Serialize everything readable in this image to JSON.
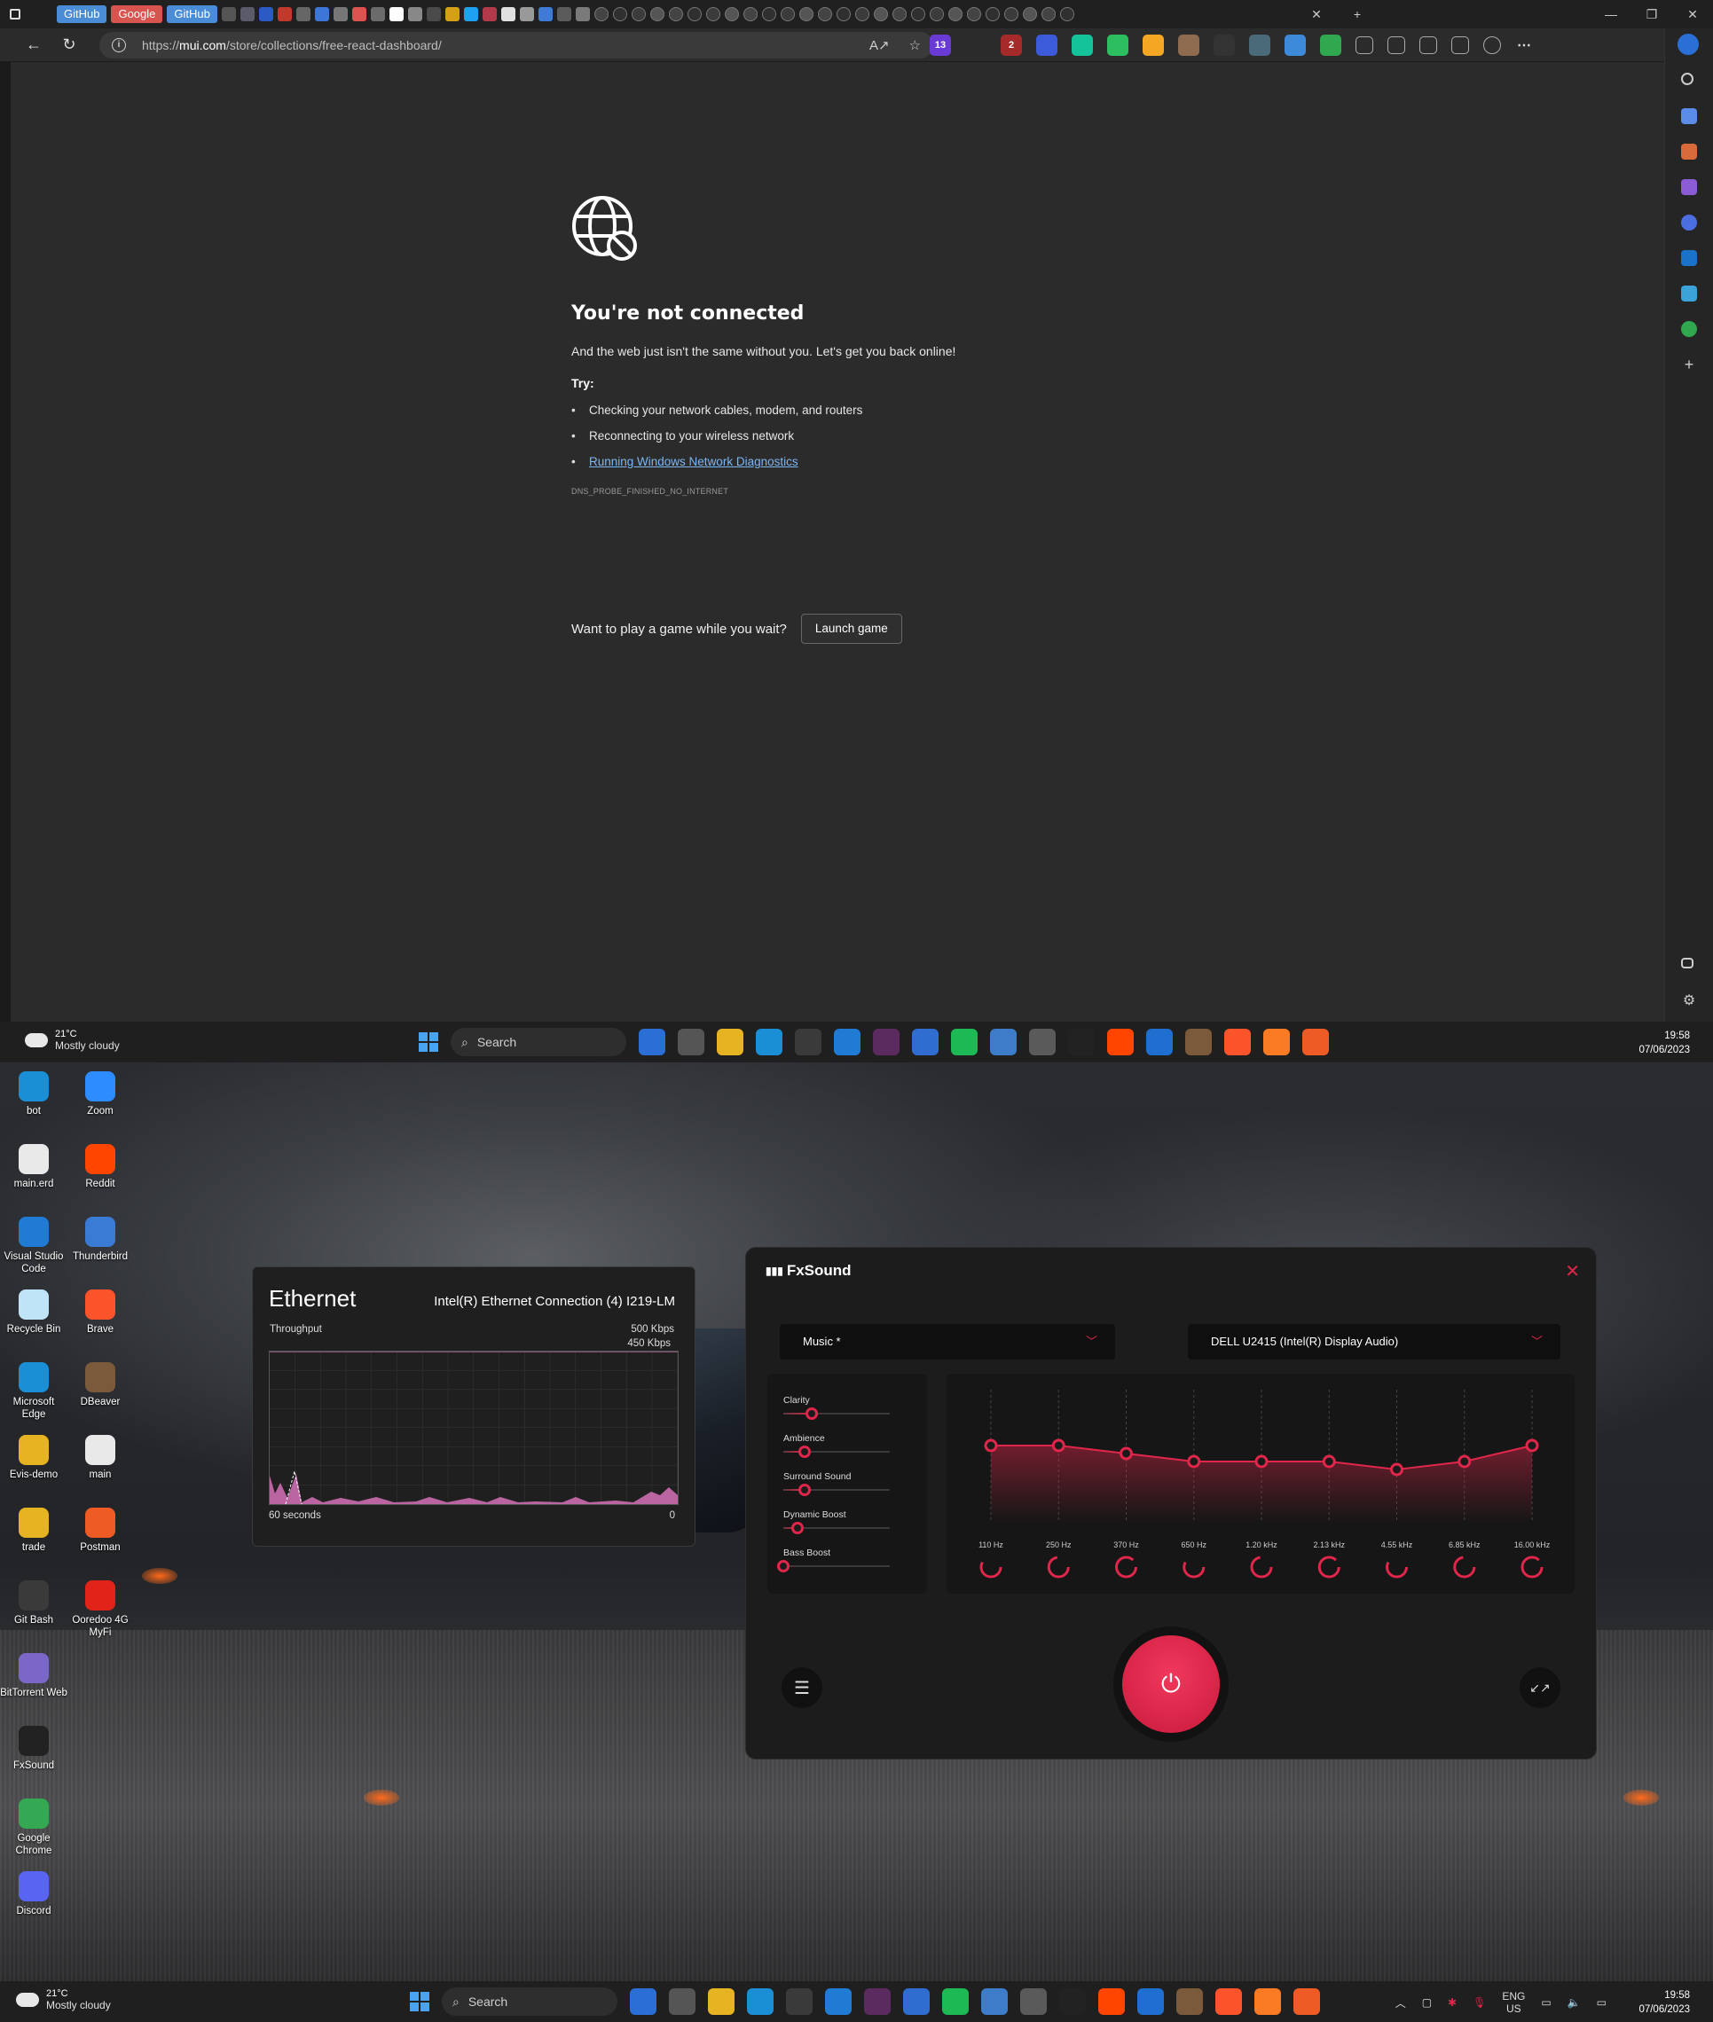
{
  "browser": {
    "tabs": {
      "pinned_labels": [
        "GitHub",
        "Google",
        "GitHub"
      ],
      "tab_colors": [
        "#555555",
        "#5a5a6a",
        "#2a5bc4",
        "#c0392b",
        "#666666",
        "#3a77d8",
        "#777777",
        "#d9534f",
        "#6b6b6b",
        "#ffffff",
        "#888888",
        "#4a4a4a",
        "#d4a017",
        "#1da1f2",
        "#b23a48",
        "#e0e0e0",
        "#999999",
        "#3e7bd6",
        "#5b5b5b",
        "#7a7a7a"
      ]
    },
    "address": {
      "url_prefix": "https://",
      "url_host": "mui.com",
      "url_path": "/store/collections/free-react-dashboard/"
    },
    "extensions": [
      {
        "icon": "extension-13-icon",
        "badge": "13",
        "color": "#6a3bd4"
      },
      {
        "icon": "x-extension-icon",
        "badge": "",
        "color": "#2b2b2b"
      },
      {
        "icon": "ublock-icon",
        "badge": "2",
        "color": "#a52a2a"
      },
      {
        "icon": "chart-extension-icon",
        "badge": "",
        "color": "#3b5bdb"
      },
      {
        "icon": "grammarly-icon",
        "badge": "",
        "color": "#15c39a"
      },
      {
        "icon": "evernote-icon",
        "badge": "",
        "color": "#2dbe60"
      },
      {
        "icon": "honey-icon",
        "badge": "",
        "color": "#f5a623"
      },
      {
        "icon": "avatar-extension-icon",
        "badge": "",
        "color": "#8e6b4f"
      },
      {
        "icon": "hat-extension-icon",
        "badge": "",
        "color": "#333333"
      },
      {
        "icon": "pen-extension-icon",
        "badge": "",
        "color": "#4a6a7a"
      },
      {
        "icon": "eyedropper-icon",
        "badge": "",
        "color": "#3d8bd8"
      },
      {
        "icon": "shield-icon",
        "badge": "",
        "color": "#2fa84f"
      }
    ],
    "error_page": {
      "title": "You're not connected",
      "subtitle": "And the web just isn't the same without you. Let's get you back online!",
      "try_label": "Try:",
      "suggestions": [
        "Checking your network cables, modem, and routers",
        "Reconnecting to your wireless network"
      ],
      "diagnostics_link": "Running Windows Network Diagnostics",
      "error_code": "DNS_PROBE_FINISHED_NO_INTERNET",
      "game_prompt": "Want to play a game while you wait?",
      "game_button": "Launch game"
    }
  },
  "taskbar": {
    "temperature": "21°C",
    "condition": "Mostly cloudy",
    "search_placeholder": "Search",
    "time": "19:58",
    "date": "07/06/2023",
    "language": "ENG",
    "region": "US",
    "apps": [
      {
        "icon": "copilot-icon",
        "color": "#2b6fd6"
      },
      {
        "icon": "task-view-icon",
        "color": "#555555"
      },
      {
        "icon": "file-explorer-icon",
        "color": "#e6b422"
      },
      {
        "icon": "edge-icon",
        "color": "#1b8fd6"
      },
      {
        "icon": "terminal-icon",
        "color": "#3a3a3a"
      },
      {
        "icon": "vscode-icon",
        "color": "#1f7bd3"
      },
      {
        "icon": "slack-icon",
        "color": "#5b2a5e"
      },
      {
        "icon": "app-store-icon",
        "color": "#2f6dd0"
      },
      {
        "icon": "spotify-icon",
        "color": "#1db954"
      },
      {
        "icon": "photos-icon",
        "color": "#3d7cc9"
      },
      {
        "icon": "settings-icon",
        "color": "#5a5a5a"
      },
      {
        "icon": "fxsound-icon",
        "color": "#222222"
      },
      {
        "icon": "reddit-icon",
        "color": "#ff4500"
      },
      {
        "icon": "onedrive-icon",
        "color": "#1e6fd0"
      },
      {
        "icon": "dbeaver-icon",
        "color": "#7a5a3a"
      },
      {
        "icon": "brave-icon",
        "color": "#fb542b"
      },
      {
        "icon": "xampp-icon",
        "color": "#fb7a24"
      },
      {
        "icon": "postman-icon",
        "color": "#ef5b25"
      }
    ]
  },
  "desktop_icons": [
    {
      "label": "bot",
      "icon": "edge-icon",
      "color": "#1b8fd6"
    },
    {
      "label": "Zoom",
      "icon": "zoom-icon",
      "color": "#2d8cff"
    },
    {
      "label": "main.erd",
      "icon": "file-icon",
      "color": "#e9e9e9"
    },
    {
      "label": "Reddit",
      "icon": "reddit-icon",
      "color": "#ff4500"
    },
    {
      "label": "Visual Studio Code",
      "icon": "vscode-icon",
      "color": "#1f7bd3"
    },
    {
      "label": "Thunderbird",
      "icon": "thunderbird-icon",
      "color": "#3a7bd5"
    },
    {
      "label": "Recycle Bin",
      "icon": "recycle-bin-icon",
      "color": "#bfe3f7"
    },
    {
      "label": "Brave",
      "icon": "brave-icon",
      "color": "#fb542b"
    },
    {
      "label": "Microsoft Edge",
      "icon": "edge-icon",
      "color": "#1b8fd6"
    },
    {
      "label": "DBeaver",
      "icon": "dbeaver-icon",
      "color": "#7a5a3a"
    },
    {
      "label": "Evis-demo",
      "icon": "folder-icon",
      "color": "#e6b422"
    },
    {
      "label": "main",
      "icon": "file-icon",
      "color": "#e9e9e9"
    },
    {
      "label": "trade",
      "icon": "folder-icon",
      "color": "#e6b422"
    },
    {
      "label": "Postman",
      "icon": "postman-icon",
      "color": "#ef5b25"
    },
    {
      "label": "Git Bash",
      "icon": "git-bash-icon",
      "color": "#3a3a3a"
    },
    {
      "label": "Ooredoo 4G MyFi",
      "icon": "ooredoo-icon",
      "color": "#e2231a"
    },
    {
      "label": "BitTorrent Web",
      "icon": "bittorrent-icon",
      "color": "#7a67c7"
    },
    {
      "label": "FxSound",
      "icon": "fxsound-icon",
      "color": "#222222"
    },
    {
      "label": "Google Chrome",
      "icon": "chrome-icon",
      "color": "#34a853"
    },
    {
      "label": "Discord",
      "icon": "discord-icon",
      "color": "#5865f2"
    }
  ],
  "ethernet": {
    "title": "Ethernet",
    "adapter": "Intel(R) Ethernet Connection (4) I219-LM",
    "throughput_label": "Throughput",
    "max_label": "500 Kbps",
    "current_label": "450 Kbps",
    "x_left": "60 seconds",
    "x_right": "0"
  },
  "fxsound": {
    "app_name": "FxSound",
    "preset": "Music *",
    "output_device": "DELL U2415 (Intel(R) Display Audio)",
    "accent": "#e0264a",
    "effects": [
      {
        "name": "Clarity",
        "level": 0.27
      },
      {
        "name": "Ambience",
        "level": 0.2
      },
      {
        "name": "Surround Sound",
        "level": 0.2
      },
      {
        "name": "Dynamic Boost",
        "level": 0.13
      },
      {
        "name": "Bass Boost",
        "level": 0.0
      }
    ],
    "eq_bands": [
      {
        "freq": "110 Hz",
        "gain": 0.52
      },
      {
        "freq": "250 Hz",
        "gain": 0.52
      },
      {
        "freq": "370 Hz",
        "gain": 0.48
      },
      {
        "freq": "650 Hz",
        "gain": 0.44
      },
      {
        "freq": "1.20 kHz",
        "gain": 0.44
      },
      {
        "freq": "2.13 kHz",
        "gain": 0.44
      },
      {
        "freq": "4.55 kHz",
        "gain": 0.4
      },
      {
        "freq": "6.85 kHz",
        "gain": 0.44
      },
      {
        "freq": "16.00 kHz",
        "gain": 0.52
      }
    ]
  }
}
